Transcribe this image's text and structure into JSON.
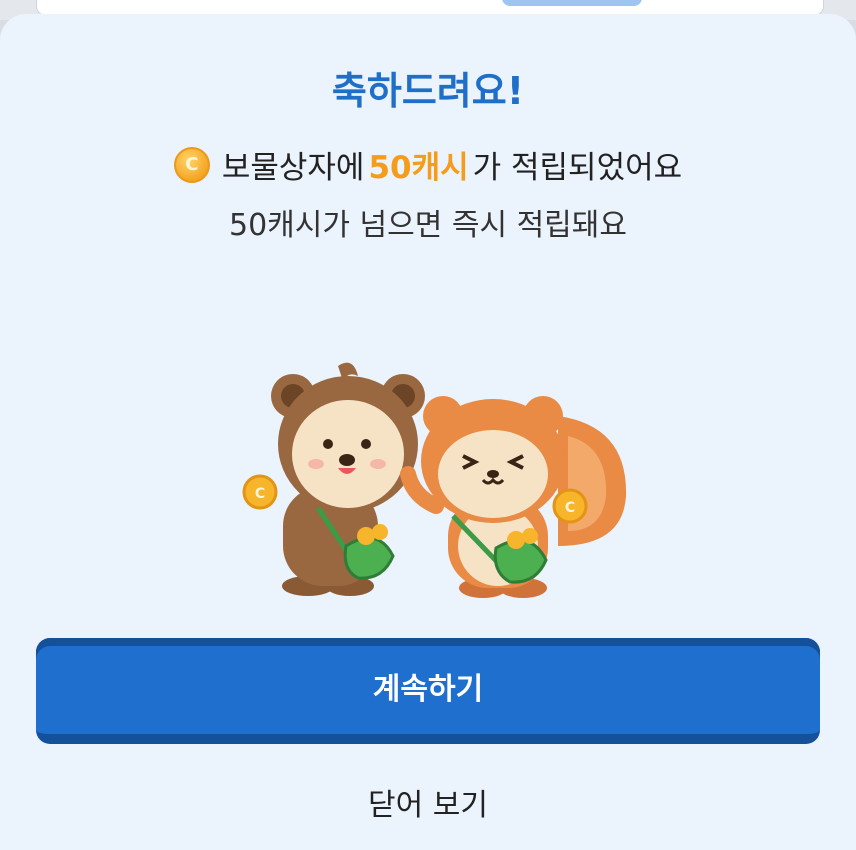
{
  "dialog": {
    "title": "축하드려요!",
    "coin_symbol": "C",
    "message_prefix": "보물상자에",
    "message_amount": "50캐시",
    "message_suffix": "가 적립되었어요",
    "sub_message": "50캐시가 넘으면 즉시 적립돼요",
    "continue_label": "계속하기",
    "close_label": "닫어 보기"
  },
  "colors": {
    "accent": "#1f6fce",
    "title": "#1f6fc9",
    "highlight": "#f59d1a",
    "sheet_bg": "#ebf3fd"
  },
  "illustration": {
    "name": "mascot-characters-holding-coins"
  }
}
